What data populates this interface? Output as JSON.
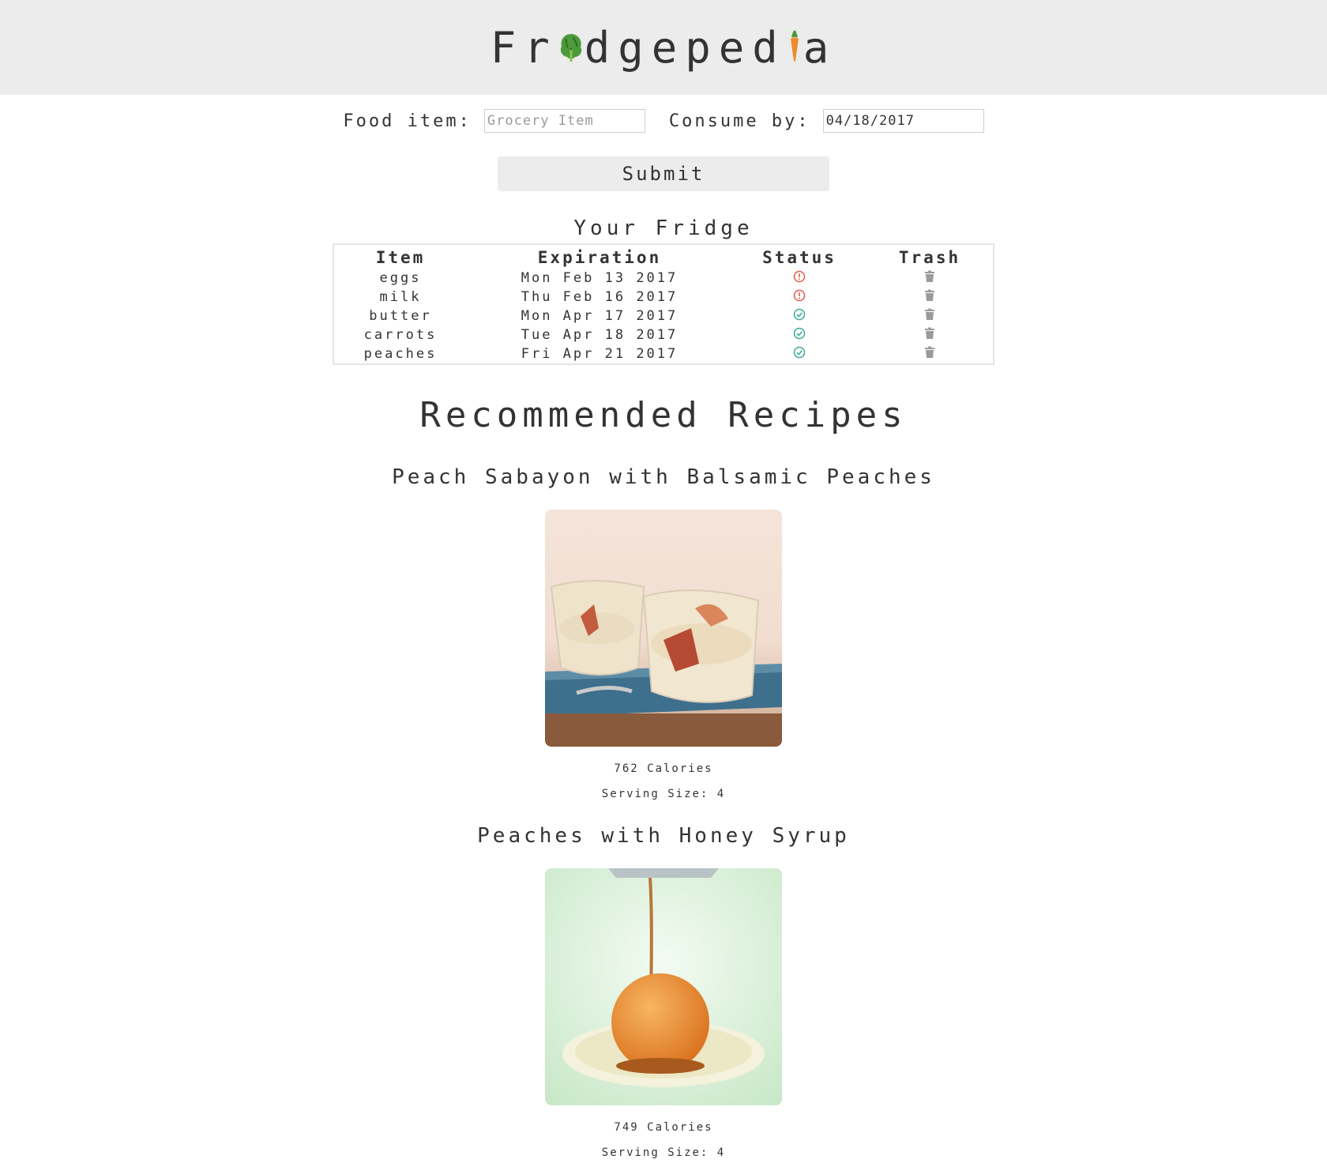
{
  "header": {
    "logo_part1": "Fr",
    "logo_icon1": "lettuce-icon",
    "logo_part2": "dgeped",
    "logo_icon2": "carrot-icon",
    "logo_part3": "a"
  },
  "form": {
    "food_label": "Food item:",
    "food_placeholder": "Grocery Item",
    "food_value": "",
    "consume_label": "Consume by:",
    "consume_value": "04/18/2017",
    "submit_label": "Submit"
  },
  "fridge": {
    "title": "Your Fridge",
    "headers": [
      "Item",
      "Expiration",
      "Status",
      "Trash"
    ],
    "rows": [
      {
        "item": "eggs",
        "expiration": "Mon Feb 13 2017",
        "status": "expired",
        "status_icon": "alert-circle-icon"
      },
      {
        "item": "milk",
        "expiration": "Thu Feb 16 2017",
        "status": "expired",
        "status_icon": "alert-circle-icon"
      },
      {
        "item": "butter",
        "expiration": "Mon Apr 17 2017",
        "status": "ok",
        "status_icon": "check-circle-icon"
      },
      {
        "item": "carrots",
        "expiration": "Tue Apr 18 2017",
        "status": "ok",
        "status_icon": "check-circle-icon"
      },
      {
        "item": "peaches",
        "expiration": "Fri Apr 21 2017",
        "status": "ok",
        "status_icon": "check-circle-icon"
      }
    ]
  },
  "recipes": {
    "heading": "Recommended Recipes",
    "items": [
      {
        "title": "Peach Sabayon with Balsamic Peaches",
        "calories": "762 Calories",
        "serving": "Serving Size: 4",
        "image": "peach-sabayon-photo"
      },
      {
        "title": "Peaches with Honey Syrup",
        "calories": "749 Calories",
        "serving": "Serving Size: 4",
        "image": "honey-peach-photo"
      }
    ]
  },
  "colors": {
    "header_bg": "#ececec",
    "expired": "#e05b4b",
    "ok": "#3aaa96",
    "trash": "#9a9a9a"
  }
}
